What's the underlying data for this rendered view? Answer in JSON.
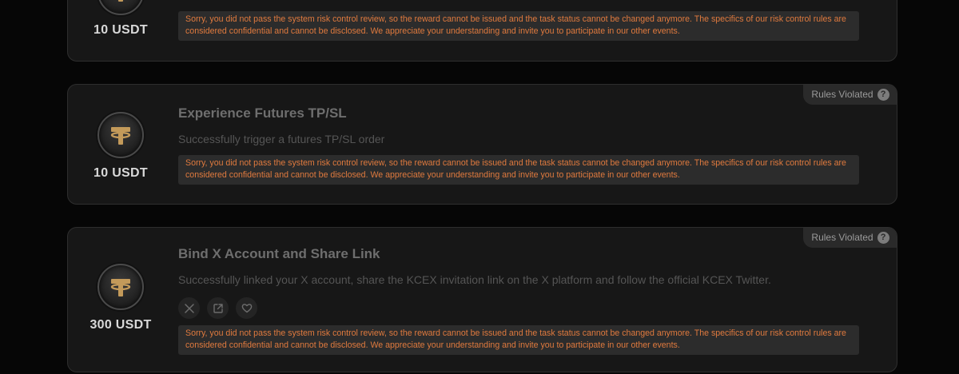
{
  "badge": {
    "label": "Rules Violated",
    "help_glyph": "?"
  },
  "tasks": [
    {
      "reward": "10 USDT",
      "title": "",
      "description": "",
      "warning": "Sorry, you did not pass the system risk control review, so the reward cannot be issued and the task status cannot be changed anymore. The specifics of our risk control rules are considered confidential and cannot be disclosed. We appreciate your understanding and invite you to participate in our other events."
    },
    {
      "reward": "10 USDT",
      "title": "Experience Futures TP/SL",
      "description": "Successfully trigger a futures TP/SL order",
      "warning": "Sorry, you did not pass the system risk control review, so the reward cannot be issued and the task status cannot be changed anymore. The specifics of our risk control rules are considered confidential and cannot be disclosed. We appreciate your understanding and invite you to participate in our other events."
    },
    {
      "reward": "300 USDT",
      "title": "Bind X Account and Share Link",
      "description": "Successfully linked your X account, share the KCEX invitation link on the X platform and follow the official KCEX Twitter.",
      "warning": "Sorry, you did not pass the system risk control review, so the reward cannot be issued and the task status cannot be changed anymore. The specifics of our risk control rules are considered confidential and cannot be disclosed. We appreciate your understanding and invite you to participate in our other events.",
      "actions": [
        "x-icon",
        "share-icon",
        "heart-icon"
      ]
    }
  ],
  "colors": {
    "warning_text": "#e07a3e",
    "coin_gold": "#c39a5a"
  }
}
